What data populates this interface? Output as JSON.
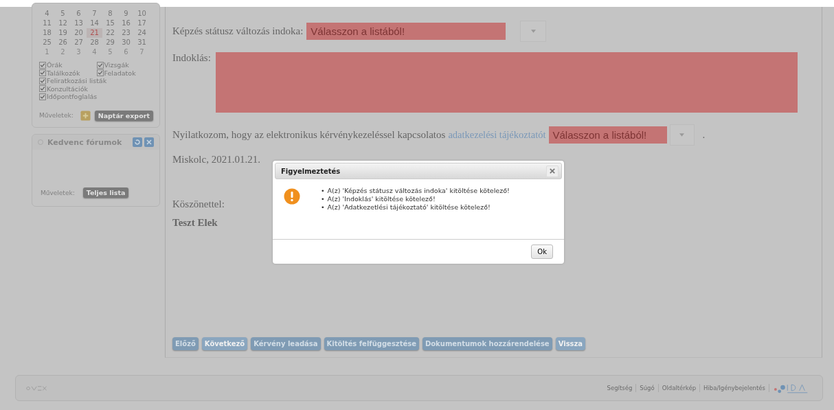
{
  "calendar": {
    "weeks": [
      [
        {
          "day": "4",
          "outside": false,
          "selected": false
        },
        {
          "day": "5",
          "outside": false,
          "selected": false
        },
        {
          "day": "6",
          "outside": false,
          "selected": false
        },
        {
          "day": "7",
          "outside": false,
          "selected": false
        },
        {
          "day": "8",
          "outside": false,
          "selected": false
        },
        {
          "day": "9",
          "outside": false,
          "selected": false
        },
        {
          "day": "10",
          "outside": false,
          "selected": false
        }
      ],
      [
        {
          "day": "11",
          "outside": false,
          "selected": false
        },
        {
          "day": "12",
          "outside": false,
          "selected": false
        },
        {
          "day": "13",
          "outside": false,
          "selected": false
        },
        {
          "day": "14",
          "outside": false,
          "selected": false
        },
        {
          "day": "15",
          "outside": false,
          "selected": false
        },
        {
          "day": "16",
          "outside": false,
          "selected": false
        },
        {
          "day": "17",
          "outside": false,
          "selected": false
        }
      ],
      [
        {
          "day": "18",
          "outside": false,
          "selected": false
        },
        {
          "day": "19",
          "outside": false,
          "selected": false
        },
        {
          "day": "20",
          "outside": false,
          "selected": false
        },
        {
          "day": "21",
          "outside": false,
          "selected": true
        },
        {
          "day": "22",
          "outside": false,
          "selected": false
        },
        {
          "day": "23",
          "outside": false,
          "selected": false
        },
        {
          "day": "24",
          "outside": false,
          "selected": false
        }
      ],
      [
        {
          "day": "25",
          "outside": false,
          "selected": false
        },
        {
          "day": "26",
          "outside": false,
          "selected": false
        },
        {
          "day": "27",
          "outside": false,
          "selected": false
        },
        {
          "day": "28",
          "outside": false,
          "selected": false
        },
        {
          "day": "29",
          "outside": false,
          "selected": false
        },
        {
          "day": "30",
          "outside": false,
          "selected": false
        },
        {
          "day": "31",
          "outside": false,
          "selected": false
        }
      ],
      [
        {
          "day": "1",
          "outside": true,
          "selected": false
        },
        {
          "day": "2",
          "outside": true,
          "selected": false
        },
        {
          "day": "3",
          "outside": true,
          "selected": false
        },
        {
          "day": "4",
          "outside": true,
          "selected": false
        },
        {
          "day": "5",
          "outside": true,
          "selected": false
        },
        {
          "day": "6",
          "outside": true,
          "selected": false
        },
        {
          "day": "7",
          "outside": true,
          "selected": false
        }
      ]
    ],
    "filters": [
      {
        "label": "Órák",
        "checked": true
      },
      {
        "label": "Vizsgák",
        "checked": true
      },
      {
        "label": "Találkozók",
        "checked": true
      },
      {
        "label": "Feladatok",
        "checked": true
      },
      {
        "label": "Feliratkozási listák",
        "checked": true
      },
      {
        "label": "Konzultációk",
        "checked": true
      },
      {
        "label": "Időpontfoglalás",
        "checked": true
      }
    ],
    "actions_label": "Műveletek:",
    "export_button": "Naptár export"
  },
  "forums": {
    "title": "Kedvenc fórumok",
    "actions_label": "Műveletek:",
    "button": "Teljes lista"
  },
  "form": {
    "reason": {
      "label": "Képzés státusz változás indoka:",
      "placeholder": "Válasszon a listából!",
      "invalid": true
    },
    "justification": {
      "label": "Indoklás:",
      "invalid": true
    },
    "statement": {
      "text": "Nyilatkozom, hogy az elektronikus kérvénykezeléssel kapcsolatos",
      "link": "adatkezelési tájékoztatót",
      "placeholder": "Válasszon a listából!",
      "invalid": true,
      "end": "."
    },
    "date": "Miskolc, 2021.01.21.",
    "closing": "Köszönettel:",
    "signature": "Teszt Elek"
  },
  "nav_buttons": [
    {
      "label": "Előző",
      "disabled": true
    },
    {
      "label": "Következő",
      "disabled": false
    },
    {
      "label": "Kérvény leadása",
      "disabled": true
    },
    {
      "label": "Kitöltés felfüggesztése",
      "disabled": true
    },
    {
      "label": "Dokumentumok hozzárendelése",
      "disabled": true
    },
    {
      "label": "Vissza",
      "disabled": false
    }
  ],
  "footer": {
    "links": [
      "Segítség",
      "Súgó",
      "Oldaltérkép",
      "Hiba/Igénybejelentés"
    ]
  },
  "dialog": {
    "title": "Figyelmeztetés",
    "messages": [
      {
        "bullet": "•",
        "text": "A(z) 'Képzés státusz változás indoka' kitöltése kötelező!"
      },
      {
        "bullet": "•",
        "text": "A(z) 'Indoklás' kitöltése kötelező!"
      },
      {
        "bullet": "•",
        "text": "A(z) 'Adatkezetlési tájékoztató' kitöltése kötelező!"
      }
    ],
    "ok": "Ok"
  }
}
